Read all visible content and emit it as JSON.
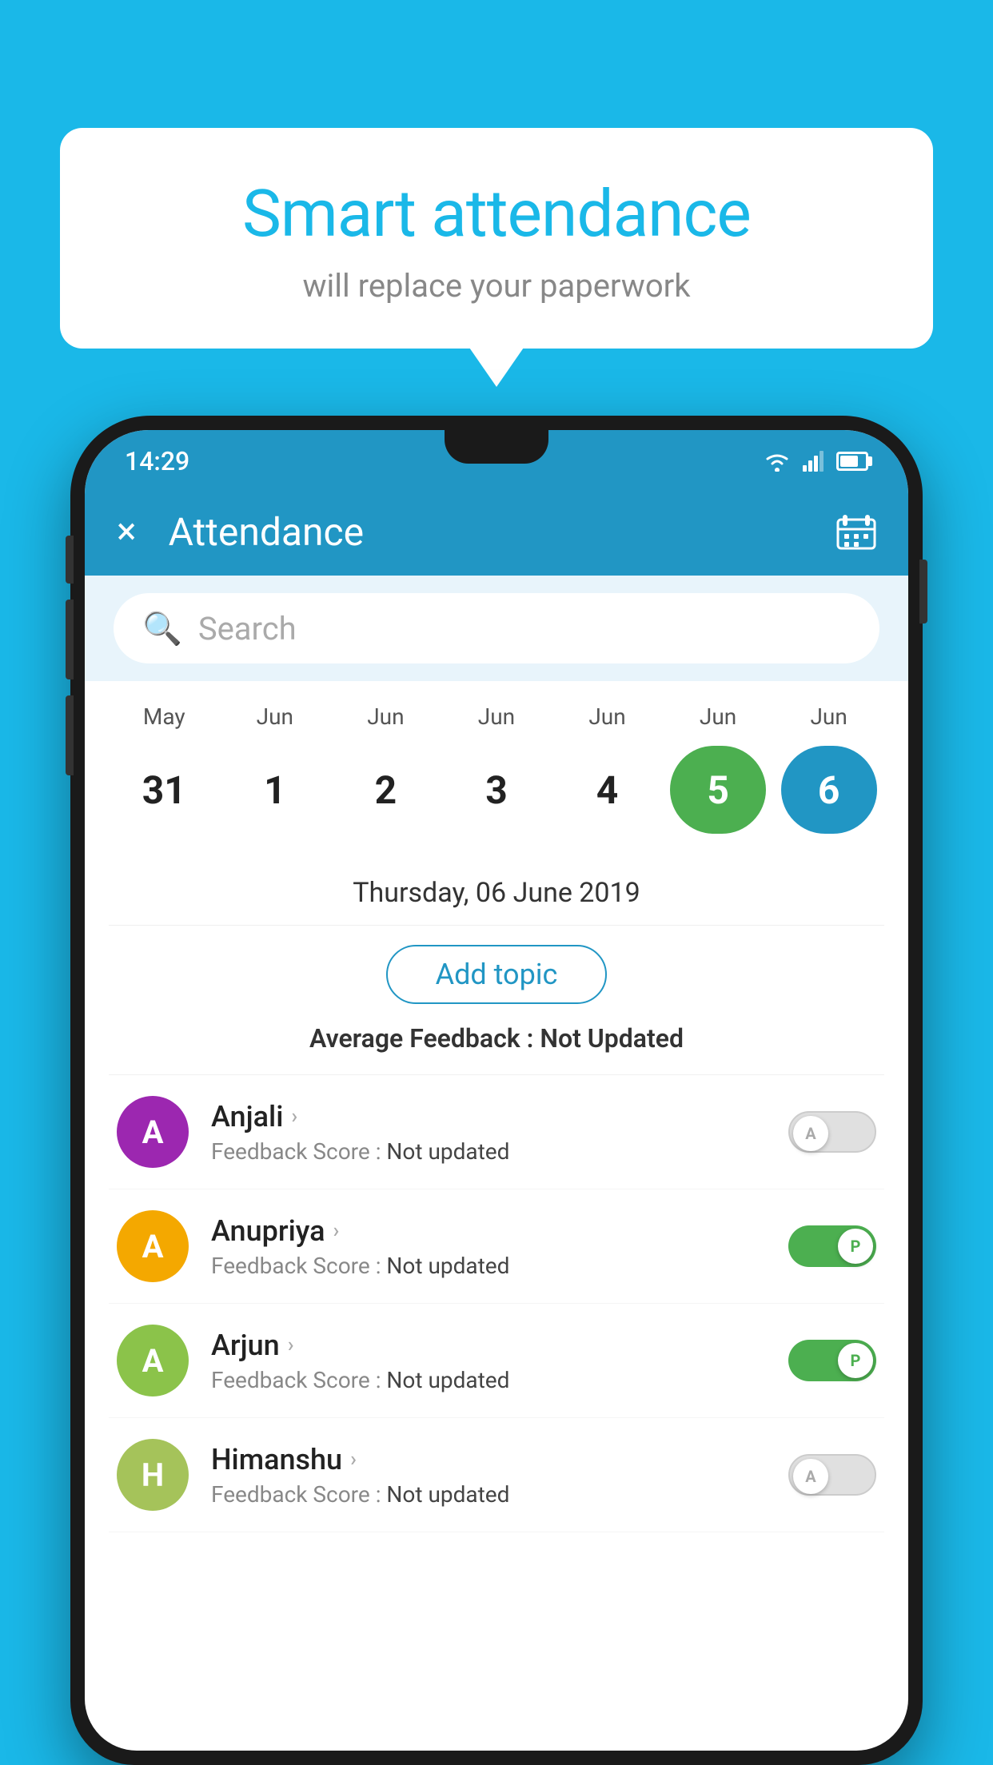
{
  "background_color": "#1ab8e8",
  "bubble": {
    "title": "Smart attendance",
    "subtitle": "will replace your paperwork"
  },
  "status_bar": {
    "time": "14:29"
  },
  "app_bar": {
    "title": "Attendance",
    "close_icon": "×",
    "calendar_icon": "📅"
  },
  "search": {
    "placeholder": "Search"
  },
  "calendar": {
    "months": [
      "May",
      "Jun",
      "Jun",
      "Jun",
      "Jun",
      "Jun",
      "Jun"
    ],
    "dates": [
      "31",
      "1",
      "2",
      "3",
      "4",
      "5",
      "6"
    ],
    "today_index": 5,
    "selected_index": 6
  },
  "date_display": "Thursday, 06 June 2019",
  "add_topic_label": "Add topic",
  "average_feedback_label": "Average Feedback : ",
  "average_feedback_value": "Not Updated",
  "students": [
    {
      "name": "Anjali",
      "avatar_letter": "A",
      "avatar_color": "#9c27b0",
      "feedback": "Not updated",
      "attendance": "A",
      "toggle_on": false
    },
    {
      "name": "Anupriya",
      "avatar_letter": "A",
      "avatar_color": "#f4a800",
      "feedback": "Not updated",
      "attendance": "P",
      "toggle_on": true
    },
    {
      "name": "Arjun",
      "avatar_letter": "A",
      "avatar_color": "#8bc34a",
      "feedback": "Not updated",
      "attendance": "P",
      "toggle_on": true
    },
    {
      "name": "Himanshu",
      "avatar_letter": "H",
      "avatar_color": "#a5c35a",
      "feedback": "Not updated",
      "attendance": "A",
      "toggle_on": false
    }
  ]
}
